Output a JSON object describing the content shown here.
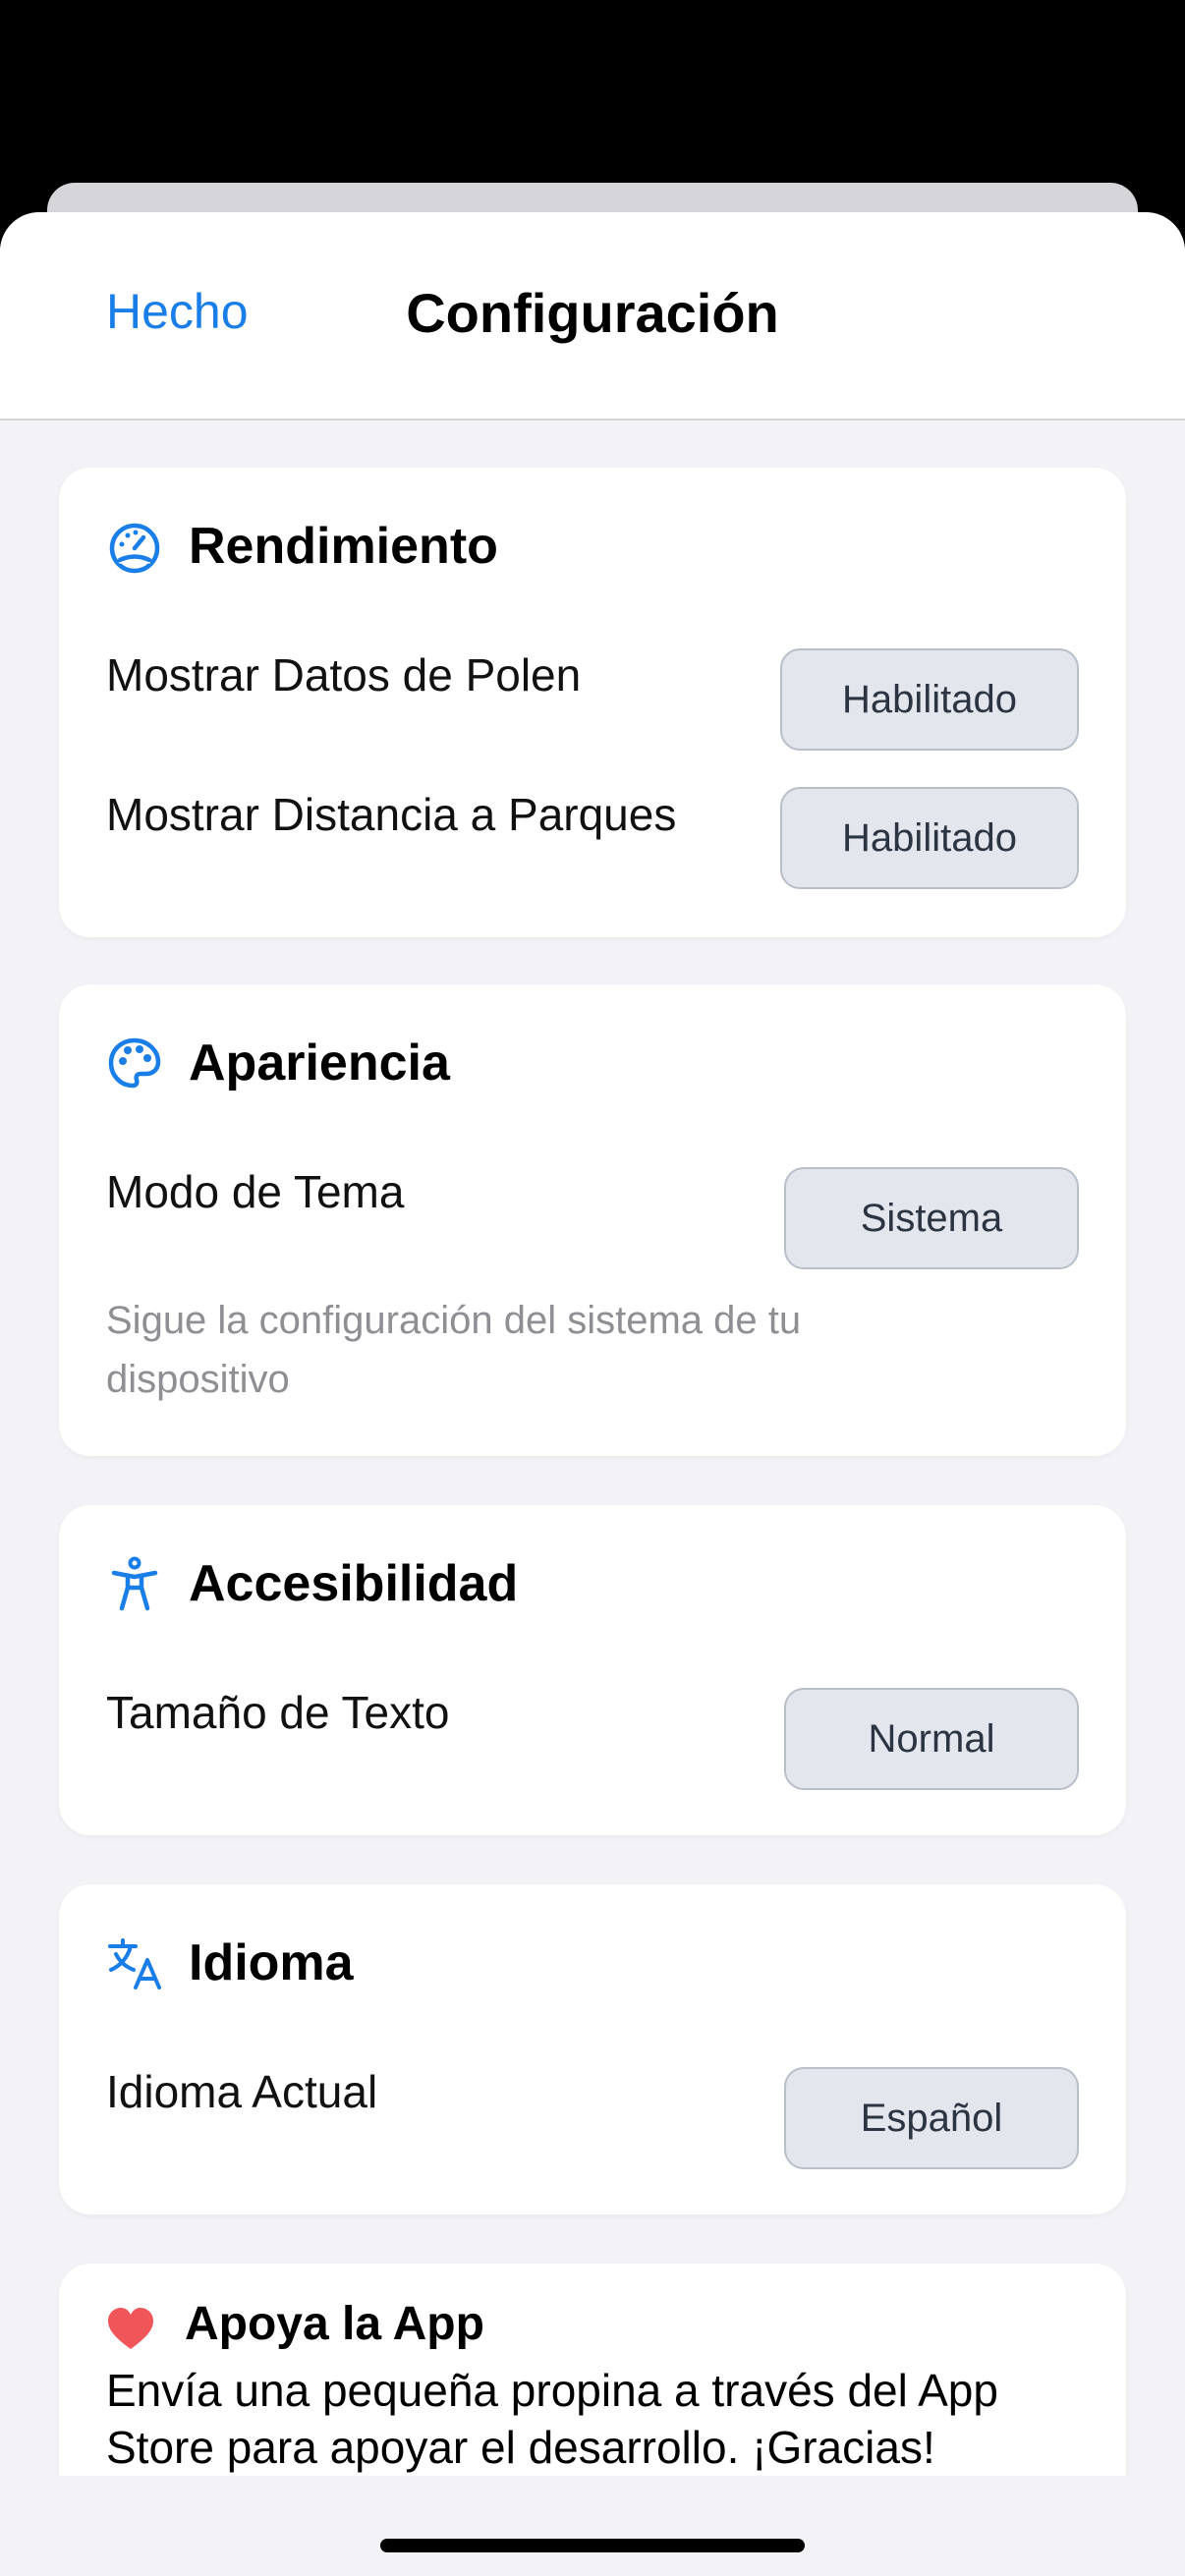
{
  "nav": {
    "done_label": "Hecho",
    "title": "Configuración"
  },
  "performance": {
    "title": "Rendimiento",
    "icon": "speedometer-icon",
    "rows": [
      {
        "label": "Mostrar Datos de Polen",
        "value": "Habilitado"
      },
      {
        "label": "Mostrar Distancia a Parques",
        "value": "Habilitado"
      }
    ]
  },
  "appearance": {
    "title": "Apariencia",
    "icon": "palette-icon",
    "theme_label": "Modo de Tema",
    "theme_value": "Sistema",
    "description": "Sigue la configuración del sistema de tu dispositivo"
  },
  "accessibility": {
    "title": "Accesibilidad",
    "icon": "accessibility-icon",
    "text_size_label": "Tamaño de Texto",
    "text_size_value": "Normal"
  },
  "language": {
    "title": "Idioma",
    "icon": "translate-icon",
    "current_label": "Idioma Actual",
    "current_value": "Español"
  },
  "support": {
    "title": "Apoya la App",
    "icon": "heart-icon",
    "text": "Envía una pequeña propina a través del App Store para apoyar el desarrollo. ¡Gracias!"
  },
  "colors": {
    "accent": "#1a7ee8",
    "heart": "#f0555a",
    "background": "#f2f2f7"
  }
}
